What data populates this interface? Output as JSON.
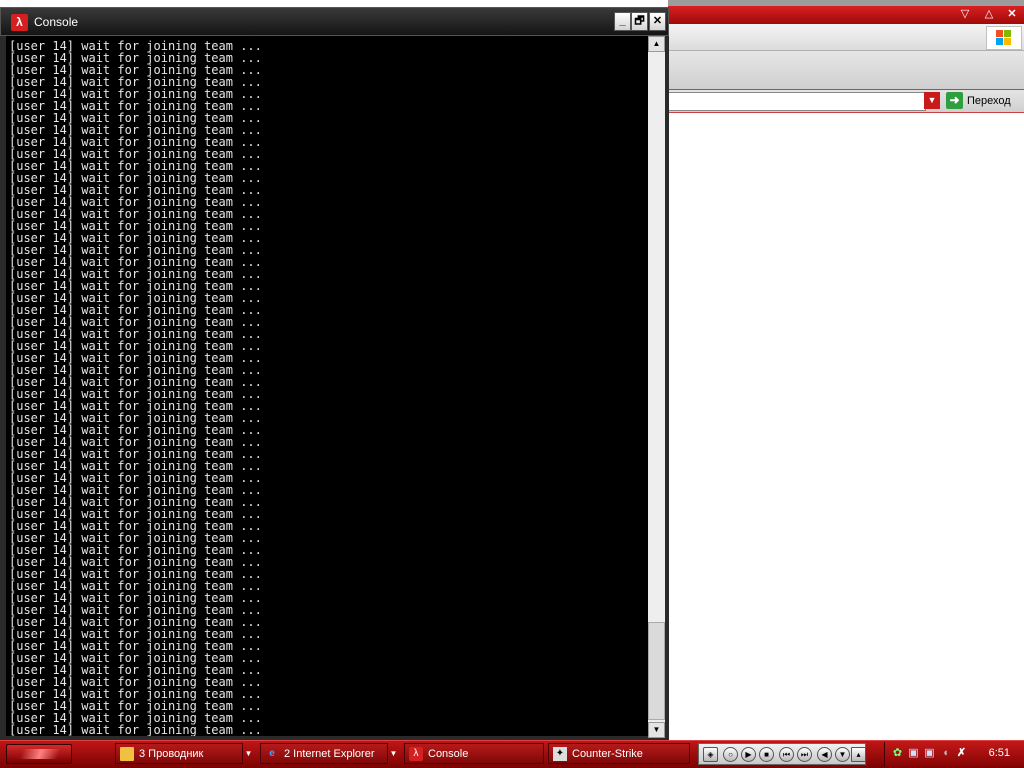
{
  "console": {
    "title": "Console",
    "line_text": "[user 14] wait for joining team ...",
    "line_count": 58,
    "minimize_glyph": "_",
    "restore_glyph": "🗗",
    "close_glyph": "✕"
  },
  "browser": {
    "go_label": "Переход"
  },
  "taskbar": {
    "tasks": [
      {
        "label": "3 Проводник",
        "icon": "folder-icon"
      },
      {
        "label": "2 Internet Explorer",
        "icon": "ie-icon"
      },
      {
        "label": "Console",
        "icon": "halflife-icon"
      },
      {
        "label": "Counter-Strike",
        "icon": "counter-strike-icon"
      }
    ],
    "clock": "6:51"
  },
  "colors": {
    "accent_red": "#c01616",
    "console_bg": "#000000",
    "console_text": "#e6e6e6"
  }
}
